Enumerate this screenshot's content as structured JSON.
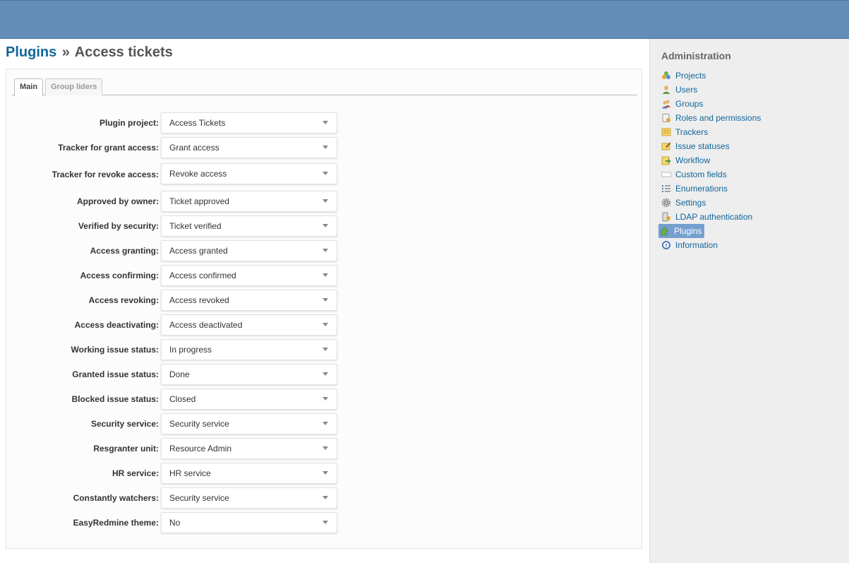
{
  "breadcrumb": {
    "parent": "Plugins",
    "separator": "»",
    "current": "Access tickets"
  },
  "tabs": [
    {
      "label": "Main",
      "selected": true
    },
    {
      "label": "Group liders",
      "selected": false
    }
  ],
  "fields": [
    {
      "label": "Plugin project:",
      "value": "Access Tickets"
    },
    {
      "label": "Tracker for grant access:",
      "value": "Grant access"
    },
    {
      "label": "Tracker for revoke access:",
      "value": "Revoke access"
    },
    {
      "label": "Approved by owner:",
      "value": "Ticket approved"
    },
    {
      "label": "Verified by security:",
      "value": "Ticket verified"
    },
    {
      "label": "Access granting:",
      "value": "Access granted"
    },
    {
      "label": "Access confirming:",
      "value": "Access confirmed"
    },
    {
      "label": "Access revoking:",
      "value": "Access revoked"
    },
    {
      "label": "Access deactivating:",
      "value": "Access deactivated"
    },
    {
      "label": "Working issue status:",
      "value": "In progress"
    },
    {
      "label": "Granted issue status:",
      "value": "Done"
    },
    {
      "label": "Blocked issue status:",
      "value": "Closed"
    },
    {
      "label": "Security service:",
      "value": "Security service"
    },
    {
      "label": "Resgranter unit:",
      "value": "Resource Admin"
    },
    {
      "label": "HR service:",
      "value": "HR service"
    },
    {
      "label": "Constantly watchers:",
      "value": "Security service"
    },
    {
      "label": "EasyRedmine theme:",
      "value": "No"
    }
  ],
  "sidebar": {
    "title": "Administration",
    "items": [
      {
        "label": "Projects",
        "icon": "projects-icon"
      },
      {
        "label": "Users",
        "icon": "user-icon"
      },
      {
        "label": "Groups",
        "icon": "group-icon"
      },
      {
        "label": "Roles and permissions",
        "icon": "roles-icon"
      },
      {
        "label": "Trackers",
        "icon": "tracker-icon"
      },
      {
        "label": "Issue statuses",
        "icon": "issue-status-icon"
      },
      {
        "label": "Workflow",
        "icon": "workflow-icon"
      },
      {
        "label": "Custom fields",
        "icon": "custom-fields-icon"
      },
      {
        "label": "Enumerations",
        "icon": "list-icon"
      },
      {
        "label": "Settings",
        "icon": "gear-icon"
      },
      {
        "label": "LDAP authentication",
        "icon": "ldap-icon"
      },
      {
        "label": "Plugins",
        "icon": "plugin-icon",
        "selected": true
      },
      {
        "label": "Information",
        "icon": "help-icon"
      }
    ]
  },
  "colors": {
    "header": "#628db6",
    "link": "#116699",
    "selected_bg": "#759fcf"
  }
}
